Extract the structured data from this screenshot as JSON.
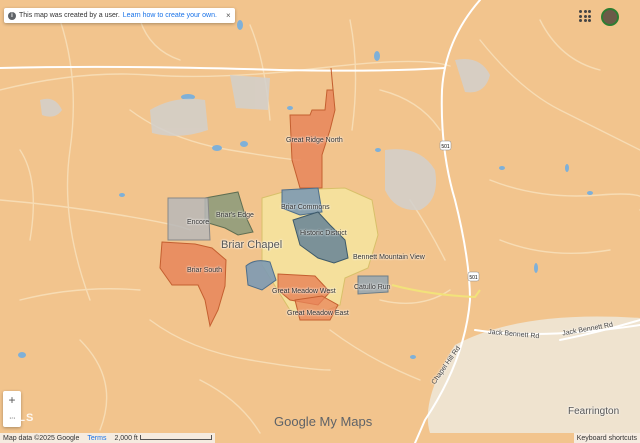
{
  "notice": {
    "text": "This map was created by a user.",
    "link": "Learn how to create your own.",
    "close": "×",
    "info": "i"
  },
  "header": {
    "apps_icon": "apps-grid-icon",
    "avatar": "user-avatar"
  },
  "neighborhoods": [
    {
      "name": "Great Ridge North",
      "color": "#e8865a"
    },
    {
      "name": "Briar Commons",
      "color": "#7d9ab3"
    },
    {
      "name": "Historic District",
      "color": "#7d9ab3"
    },
    {
      "name": "Briar's Edge",
      "color": "#8a9a7a"
    },
    {
      "name": "Encore",
      "color": "#b8b8b8"
    },
    {
      "name": "Briar South",
      "color": "#e8865a"
    },
    {
      "name": "Bennett Mountain View",
      "color": "#f5e7a0"
    },
    {
      "name": "Catullo Run",
      "color": "#9aa8b0"
    },
    {
      "name": "Great Meadow West",
      "color": "#e8865a"
    },
    {
      "name": "Great Meadow East",
      "color": "#e8865a"
    }
  ],
  "places": {
    "briar_chapel": "Briar Chapel",
    "fearrington": "Fearrington"
  },
  "roads": {
    "jack_bennett_1": "Jack Bennett Rd",
    "jack_bennett_2": "Jack Bennett Rd",
    "chapel_hill": "Chapel Hill Rd",
    "r501a": "501",
    "r501b": "501"
  },
  "controls": {
    "zoom_in": "+",
    "zoom_out": "−"
  },
  "footer": {
    "map_data": "Map data ©2025 Google",
    "terms": "Terms",
    "scale": "2,000 ft",
    "keyboard": "Keyboard shortcuts"
  },
  "branding": {
    "google": "Google",
    "my_maps": " My Maps",
    "watermark": "IMLS"
  }
}
